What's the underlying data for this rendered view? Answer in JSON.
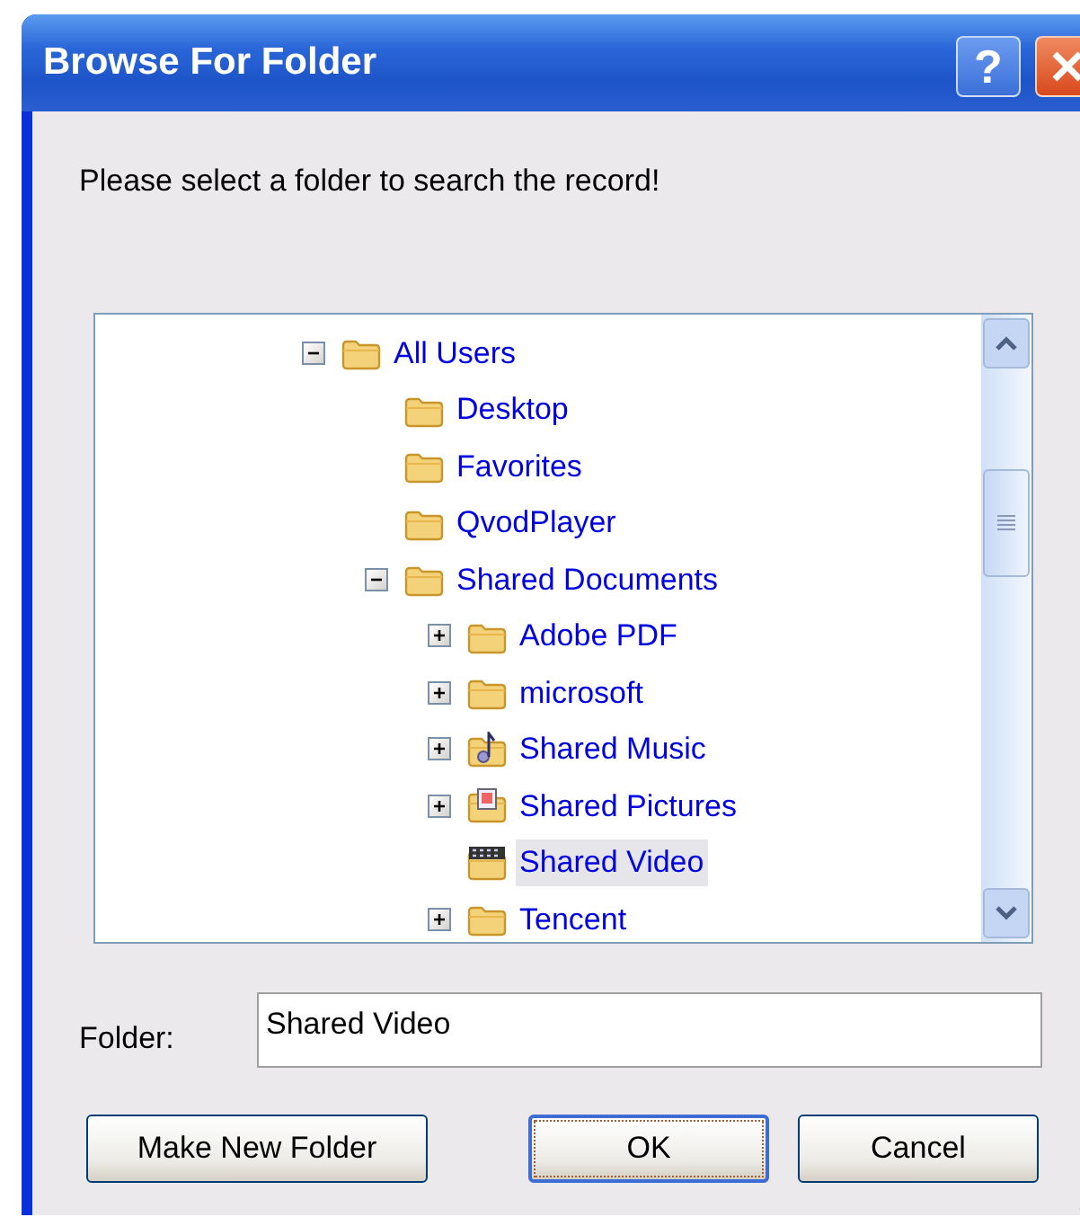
{
  "window": {
    "title": "Browse For Folder",
    "title_buttons": [
      {
        "kind": "help",
        "label": "?"
      },
      {
        "kind": "close"
      }
    ]
  },
  "prompt": "Please select a folder to search the record!",
  "tree": [
    {
      "label": "All Users",
      "kind": "folder",
      "expanded": true,
      "selected": false,
      "children": [
        {
          "label": "Desktop",
          "kind": "folder",
          "selected": false
        },
        {
          "label": "Favorites",
          "kind": "folder",
          "selected": false
        },
        {
          "label": "QvodPlayer",
          "kind": "folder",
          "selected": false
        },
        {
          "label": "Shared Documents",
          "kind": "folder",
          "expanded": true,
          "selected": false,
          "children": [
            {
              "label": "Adobe PDF",
              "kind": "folder",
              "expanded": false,
              "selected": false
            },
            {
              "label": "microsoft",
              "kind": "folder",
              "expanded": false,
              "selected": false
            },
            {
              "label": "Shared Music",
              "kind": "music",
              "expanded": false,
              "selected": false
            },
            {
              "label": "Shared Pictures",
              "kind": "pictures",
              "expanded": false,
              "selected": false
            },
            {
              "label": "Shared Video",
              "kind": "video",
              "selected": true
            },
            {
              "label": "Tencent",
              "kind": "folder",
              "expanded": false,
              "selected": false
            }
          ]
        }
      ]
    }
  ],
  "folder_field": {
    "label": "Folder:",
    "value": "Shared Video"
  },
  "buttons": [
    {
      "label": "Make New Folder",
      "default": false
    },
    {
      "label": "OK",
      "default": true
    },
    {
      "label": "Cancel",
      "default": false
    }
  ]
}
